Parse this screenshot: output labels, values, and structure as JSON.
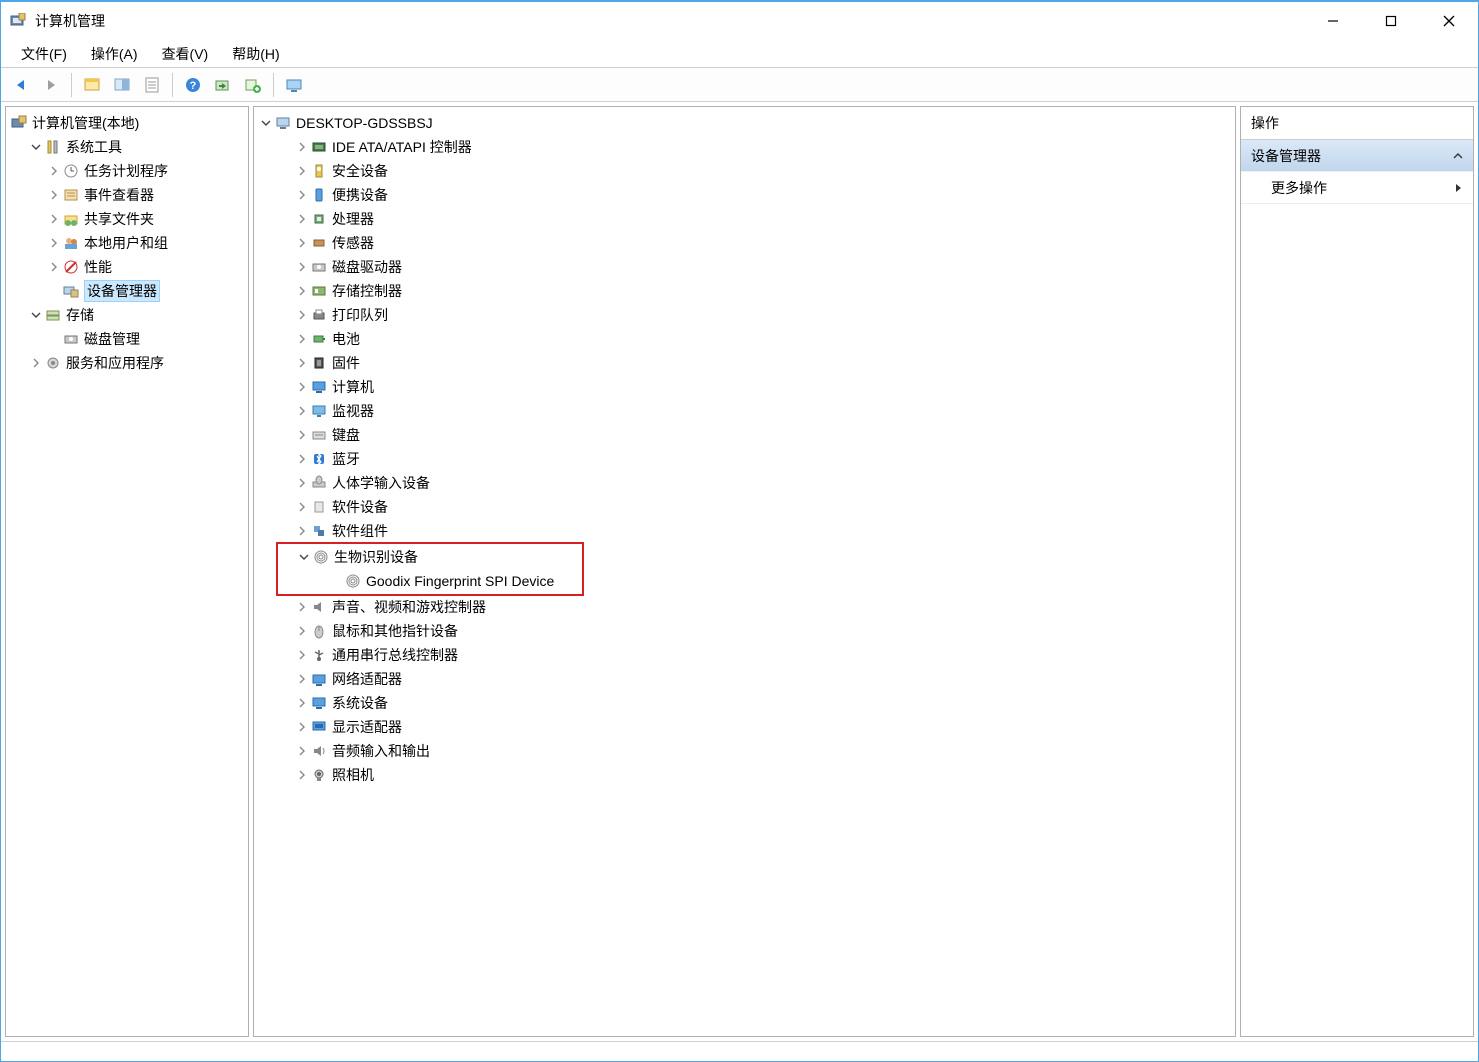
{
  "window": {
    "title": "计算机管理"
  },
  "menus": {
    "file": "文件(F)",
    "action": "操作(A)",
    "view": "查看(V)",
    "help": "帮助(H)"
  },
  "left_tree": {
    "root": "计算机管理(本地)",
    "system_tools": "系统工具",
    "task_scheduler": "任务计划程序",
    "event_viewer": "事件查看器",
    "shared_folders": "共享文件夹",
    "local_users_groups": "本地用户和组",
    "performance": "性能",
    "device_manager": "设备管理器",
    "storage": "存储",
    "disk_management": "磁盘管理",
    "services_apps": "服务和应用程序"
  },
  "center_tree": {
    "root": "DESKTOP-GDSSBSJ",
    "ide_ata": "IDE ATA/ATAPI 控制器",
    "security_devices": "安全设备",
    "portable_devices": "便携设备",
    "processors": "处理器",
    "sensors": "传感器",
    "disk_drives": "磁盘驱动器",
    "storage_controllers": "存储控制器",
    "print_queues": "打印队列",
    "batteries": "电池",
    "firmware": "固件",
    "computer": "计算机",
    "monitors": "监视器",
    "keyboards": "键盘",
    "bluetooth": "蓝牙",
    "hid": "人体学输入设备",
    "software_devices": "软件设备",
    "software_components": "软件组件",
    "biometric_devices": "生物识别设备",
    "goodix": "Goodix Fingerprint SPI Device",
    "sound_video_game": "声音、视频和游戏控制器",
    "mice_pointing": "鼠标和其他指针设备",
    "usb_controllers": "通用串行总线控制器",
    "network_adapters": "网络适配器",
    "system_devices": "系统设备",
    "display_adapters": "显示适配器",
    "audio_io": "音频输入和输出",
    "cameras": "照相机"
  },
  "right_panel": {
    "header": "操作",
    "section": "设备管理器",
    "more_actions": "更多操作"
  }
}
